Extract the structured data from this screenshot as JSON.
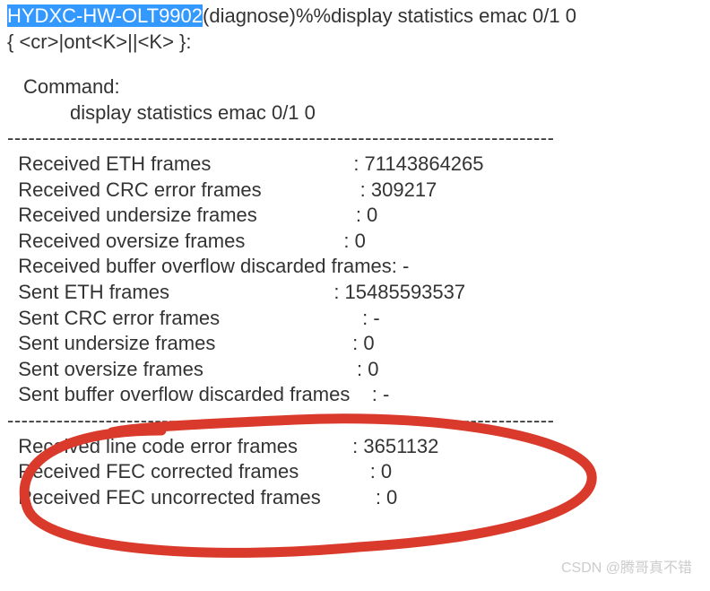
{
  "prompt": {
    "hostname": "HYDXC-HW-OLT9902",
    "context": "(diagnose)%%display statistics emac 0/1 0",
    "options": "{ <cr>|ont<K>||<K> }:"
  },
  "command": {
    "label": "Command:",
    "text": "display statistics emac 0/1 0"
  },
  "dashes": "  ------------------------------------------------------------------------------",
  "stats": [
    {
      "label": "  Received ETH frames                          ",
      "value": ": 71143864265"
    },
    {
      "label": "  Received CRC error frames                  ",
      "value": ": 309217"
    },
    {
      "label": "  Received undersize frames                  ",
      "value": ": 0"
    },
    {
      "label": "  Received oversize frames                  ",
      "value": ": 0"
    },
    {
      "label": "  Received buffer overflow discarded frames",
      "value": ": -"
    },
    {
      "label": "  Sent ETH frames                              ",
      "value": ": 15485593537"
    },
    {
      "label": "  Sent CRC error frames                          ",
      "value": ": -"
    },
    {
      "label": "  Sent undersize frames                         ",
      "value": ": 0"
    },
    {
      "label": "  Sent oversize frames                            ",
      "value": ": 0"
    },
    {
      "label": "  Sent buffer overflow discarded frames    ",
      "value": ": -"
    }
  ],
  "stats2": [
    {
      "label": "  Received line code error frames          ",
      "value": ": 3651132"
    },
    {
      "label": "  Received FEC corrected frames             ",
      "value": ": 0"
    },
    {
      "label": "  Received FEC uncorrected frames          ",
      "value": ": 0"
    }
  ],
  "watermark": "CSDN @腾哥真不错",
  "annotation_color": "#d93a2b"
}
